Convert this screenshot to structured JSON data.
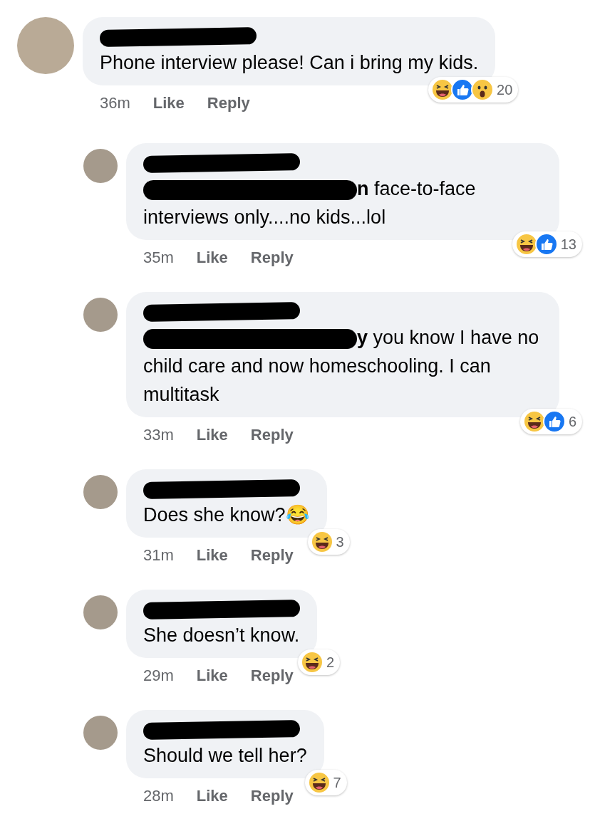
{
  "comments": [
    {
      "reply": false,
      "text": "Phone interview please! Can i bring my kids.",
      "time": "36m",
      "actions": [
        "Like",
        "Reply"
      ],
      "reactions": [
        {
          "kind": "haha"
        },
        {
          "kind": "like"
        },
        {
          "kind": "wow"
        }
      ],
      "count": "20"
    },
    {
      "reply": true,
      "mention_tail": "n",
      "text": "face-to-face interviews only....no kids...lol",
      "time": "35m",
      "actions": [
        "Like",
        "Reply"
      ],
      "reactions": [
        {
          "kind": "haha"
        },
        {
          "kind": "like"
        }
      ],
      "count": "13"
    },
    {
      "reply": true,
      "mention_tail": "y",
      "text": "you know I have no child care and now homeschooling. I can multitask",
      "time": "33m",
      "actions": [
        "Like",
        "Reply"
      ],
      "reactions": [
        {
          "kind": "haha"
        },
        {
          "kind": "like"
        }
      ],
      "count": "6"
    },
    {
      "reply": true,
      "text": "Does she know?😂",
      "time": "31m",
      "actions": [
        "Like",
        "Reply"
      ],
      "reactions": [
        {
          "kind": "haha"
        }
      ],
      "count": "3"
    },
    {
      "reply": true,
      "text": "She doesn’t know.",
      "time": "29m",
      "actions": [
        "Like",
        "Reply"
      ],
      "reactions": [
        {
          "kind": "haha"
        }
      ],
      "count": "2"
    },
    {
      "reply": true,
      "text": "Should we tell her?",
      "time": "28m",
      "actions": [
        "Like",
        "Reply"
      ],
      "reactions": [
        {
          "kind": "haha"
        }
      ],
      "count": "7"
    }
  ]
}
